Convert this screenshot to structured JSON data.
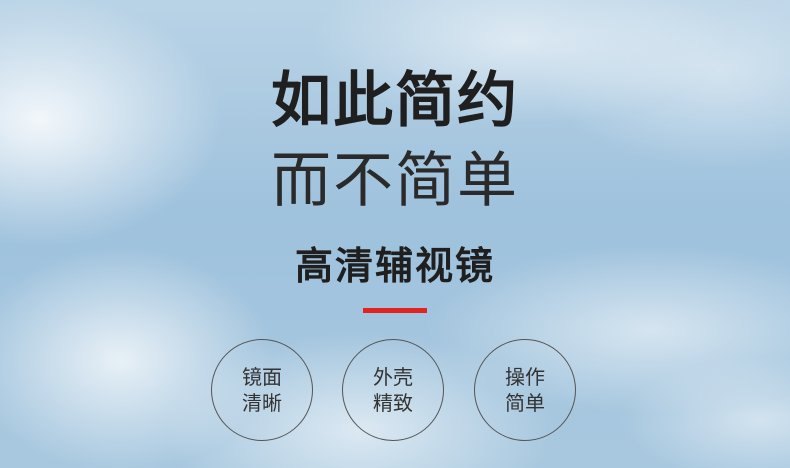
{
  "headline": {
    "line1": "如此简约",
    "line2": "而不简单"
  },
  "product_name": "高清辅视镜",
  "colors": {
    "accent": "#e32222",
    "sky": "#a9c9e0",
    "text": "#1f1f1f"
  },
  "features": [
    {
      "line1": "镜面",
      "line2": "清晰"
    },
    {
      "line1": "外壳",
      "line2": "精致"
    },
    {
      "line1": "操作",
      "line2": "简单"
    }
  ]
}
